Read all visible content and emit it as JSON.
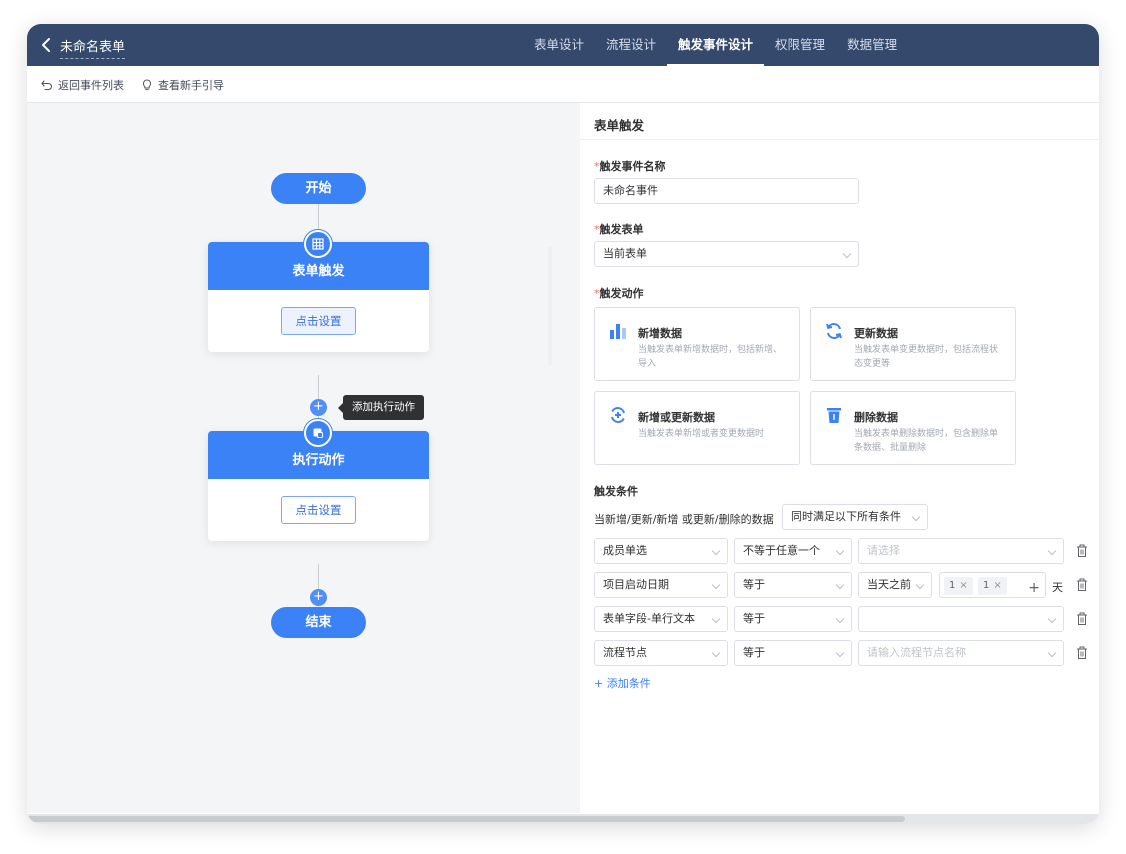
{
  "header": {
    "form_title": "未命名表单",
    "tabs": [
      {
        "label": "表单设计"
      },
      {
        "label": "流程设计"
      },
      {
        "label": "触发事件设计"
      },
      {
        "label": "权限管理"
      },
      {
        "label": "数据管理"
      }
    ],
    "active_tab": "触发事件设计"
  },
  "toolbar": {
    "back_label": "返回事件列表",
    "guide_label": "查看新手引导"
  },
  "flow": {
    "start_label": "开始",
    "trigger_node_title": "表单触发",
    "trigger_node_button": "点击设置",
    "add_action_tooltip": "添加执行动作",
    "action_node_title": "执行动作",
    "action_node_button": "点击设置",
    "end_label": "结束"
  },
  "panel": {
    "title": "表单触发",
    "event_name_label": "触发事件名称",
    "event_name_value": "未命名事件",
    "trigger_form_label": "触发表单",
    "trigger_form_value": "当前表单",
    "trigger_action_label": "触发动作",
    "actions": [
      {
        "title": "新增数据",
        "desc": "当触发表单新增数据时，包括新增、导入",
        "icon": "bar-chart-icon"
      },
      {
        "title": "更新数据",
        "desc": "当触发表单变更数据时，包括流程状态变更等",
        "icon": "refresh-icon"
      },
      {
        "title": "新增或更新数据",
        "desc": "当触发表单新增或者变更数据时",
        "icon": "add-refresh-icon"
      },
      {
        "title": "删除数据",
        "desc": "当触发表单删除数据时，包含删除单条数据、批量删除",
        "icon": "trash-icon"
      }
    ],
    "conditions_title": "触发条件",
    "conditions_desc": "当新增/更新/新增 或更新/删除的数据",
    "match_mode": "同时满足以下所有条件",
    "conditions": [
      {
        "field": "成员单选",
        "operator": "不等于任意一个",
        "value": "",
        "placeholder": "请选择"
      },
      {
        "field": "项目启动日期",
        "operator": "等于",
        "value": "当天之前",
        "tag1": "1",
        "tag2": "1",
        "unit": "天"
      },
      {
        "field": "表单字段-单行文本",
        "operator": "等于",
        "value": "",
        "placeholder": ""
      },
      {
        "field": "流程节点",
        "operator": "等于",
        "value": "",
        "placeholder": "请输入流程节点名称"
      }
    ],
    "add_condition_label": "+ 添加条件"
  },
  "colors": {
    "header_bg": "#34496b",
    "accent": "#3b82f6",
    "required": "#f56c6c"
  }
}
